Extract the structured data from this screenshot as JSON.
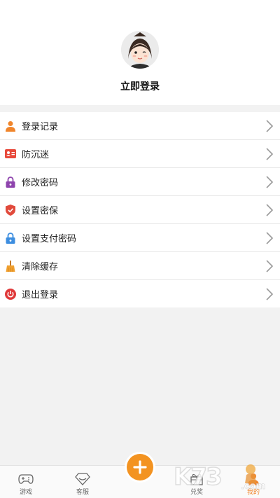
{
  "profile": {
    "login_label": "立即登录"
  },
  "menu": {
    "items": [
      {
        "label": "登录记录",
        "icon": "person-icon",
        "color": "#f0852b"
      },
      {
        "label": "防沉迷",
        "icon": "id-card-icon",
        "color": "#e8493b"
      },
      {
        "label": "修改密码",
        "icon": "lock-icon",
        "color": "#8e44ad"
      },
      {
        "label": "设置密保",
        "icon": "shield-icon",
        "color": "#e14a3c"
      },
      {
        "label": "设置支付密码",
        "icon": "lock-icon",
        "color": "#3d8ee0"
      },
      {
        "label": "清除缓存",
        "icon": "broom-icon",
        "color": "#f0a030"
      },
      {
        "label": "退出登录",
        "icon": "power-icon",
        "color": "#e0393a"
      }
    ]
  },
  "tabbar": {
    "items": [
      {
        "label": "游戏",
        "icon": "gamepad-icon"
      },
      {
        "label": "客服",
        "icon": "diamond-icon"
      },
      {
        "label": "兑奖",
        "icon": "gift-icon"
      },
      {
        "label": "我的",
        "icon": "user-icon",
        "active": true
      }
    ],
    "fab_icon": "plus-icon"
  },
  "watermark_text": "K73.com",
  "colors": {
    "accent": "#f39321",
    "background": "#f2f2f2"
  }
}
